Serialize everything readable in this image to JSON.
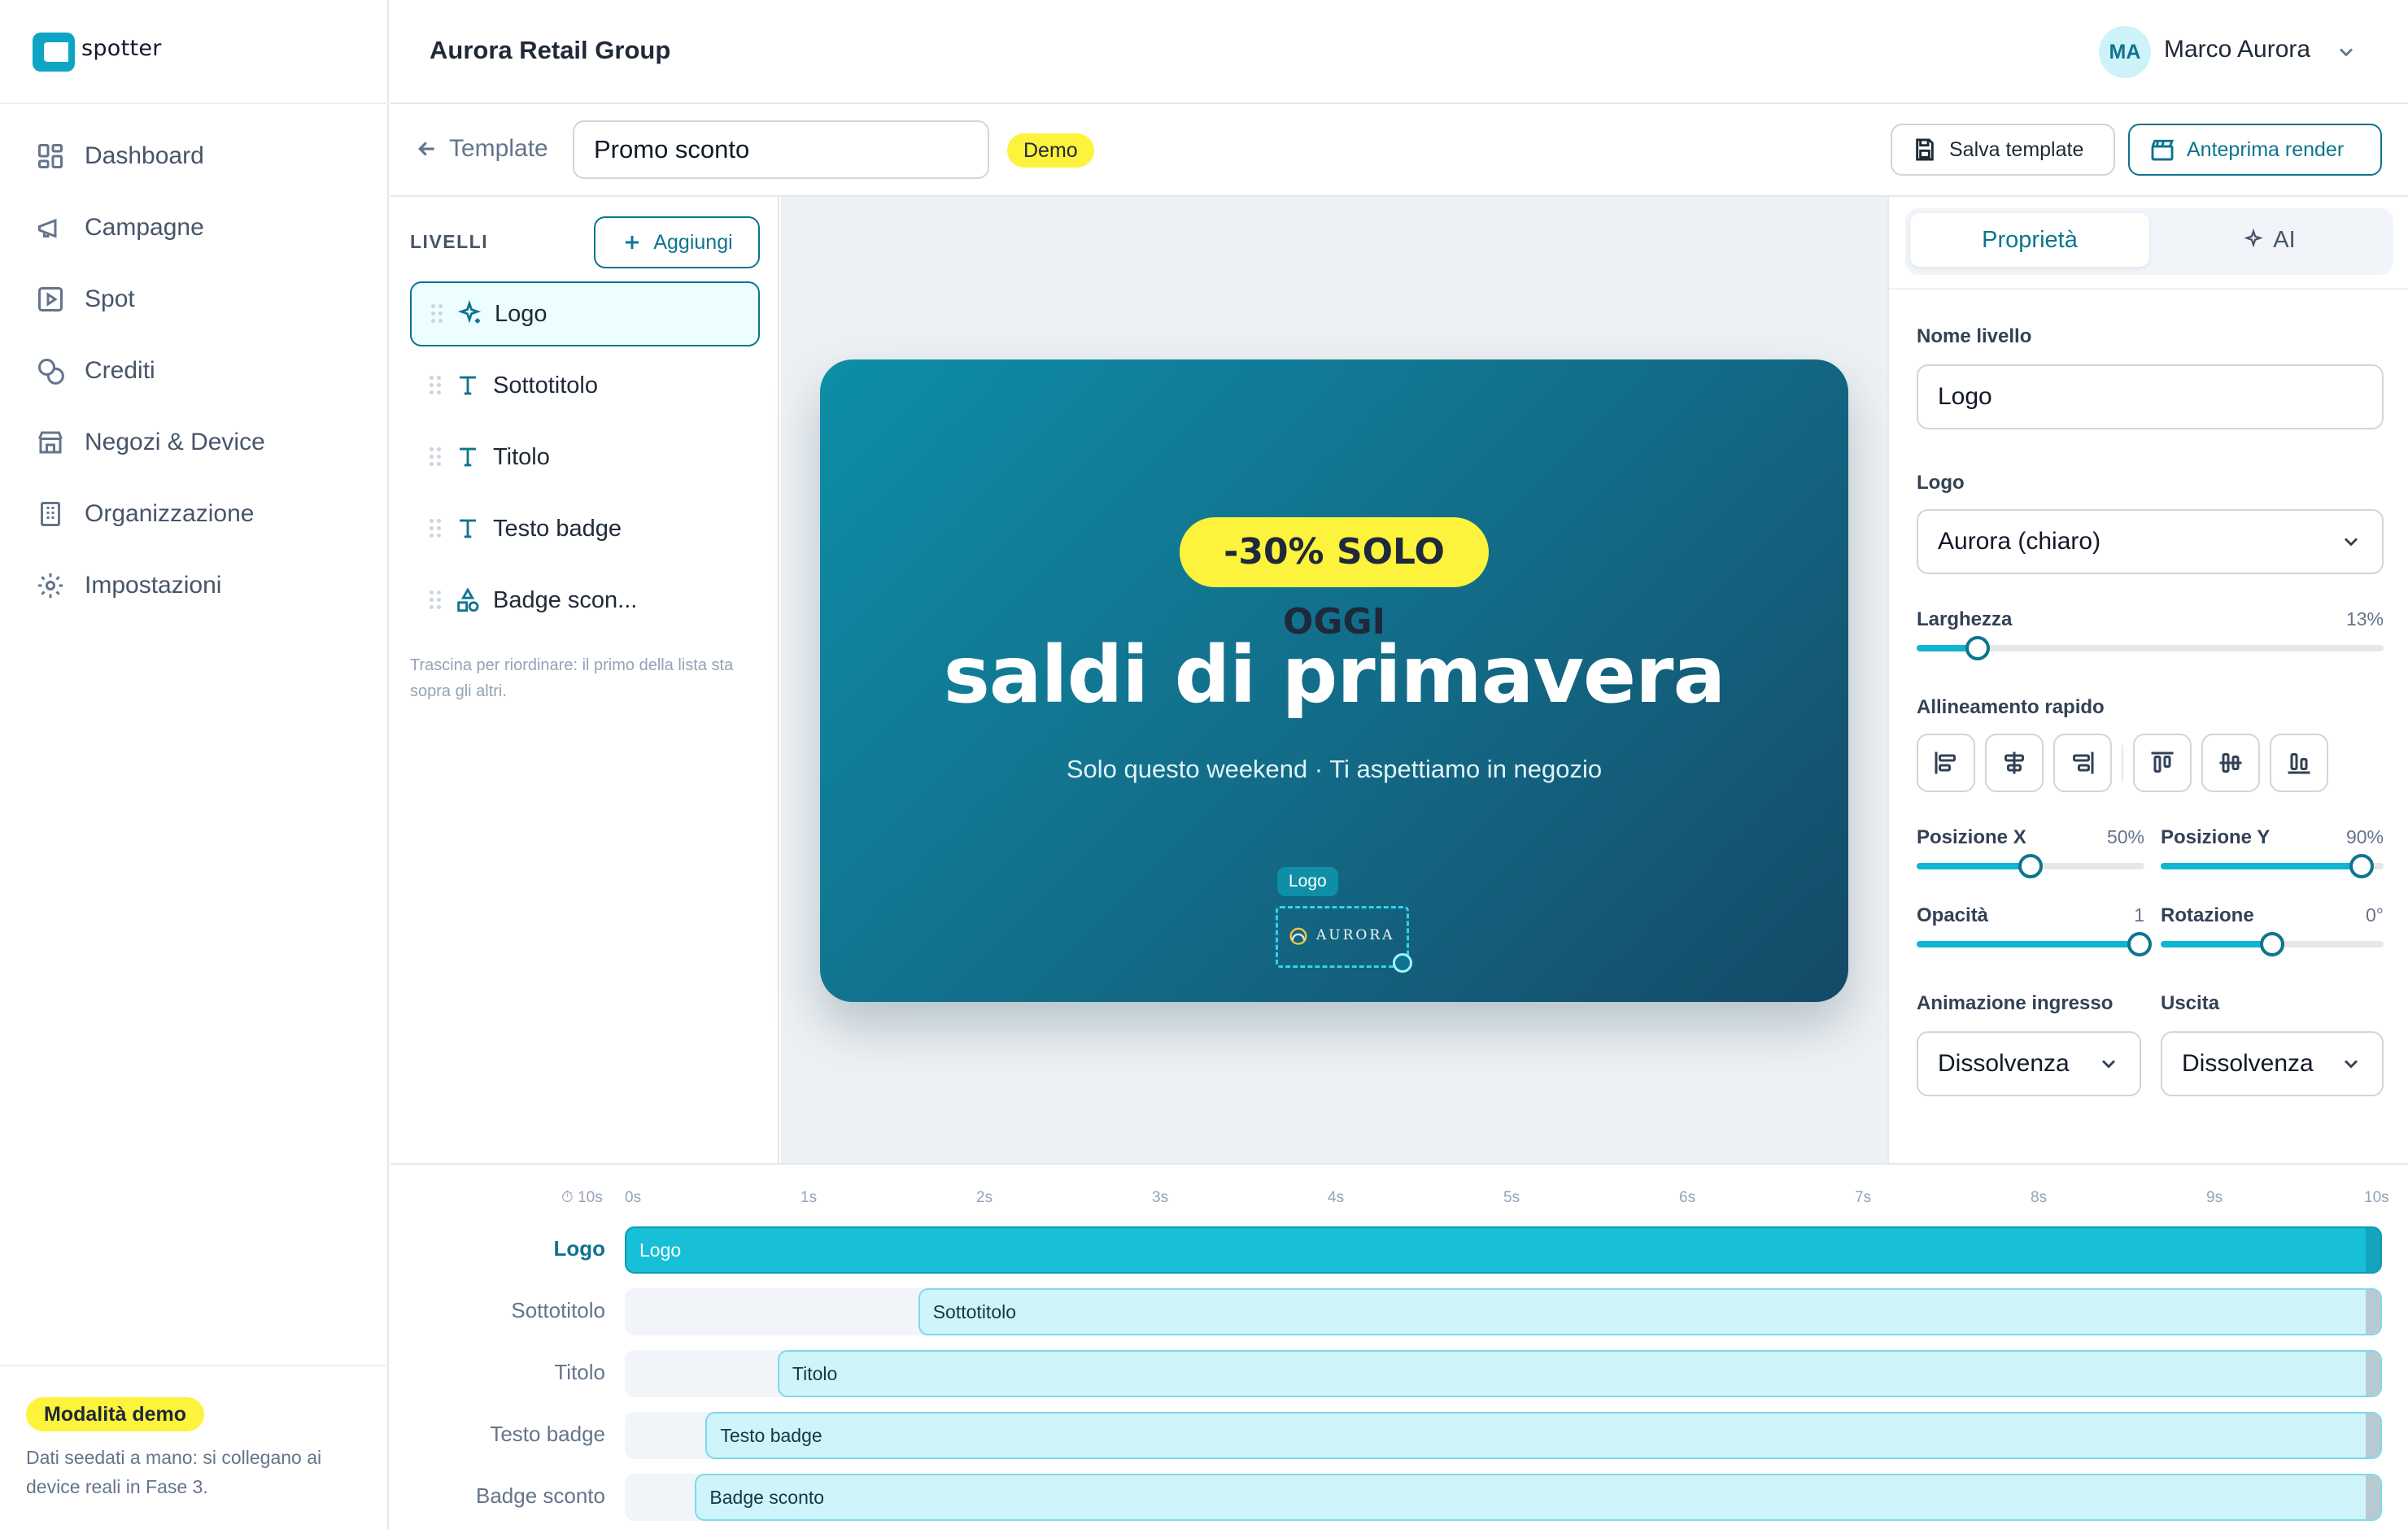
{
  "app": {
    "brand": "spotter",
    "org_title": "Aurora Retail Group",
    "user": {
      "initials": "MA",
      "name": "Marco Aurora"
    }
  },
  "sidebar": {
    "items": [
      {
        "label": "Dashboard",
        "icon": "grid-icon"
      },
      {
        "label": "Campagne",
        "icon": "megaphone-icon"
      },
      {
        "label": "Spot",
        "icon": "play-square-icon"
      },
      {
        "label": "Crediti",
        "icon": "coins-icon"
      },
      {
        "label": "Negozi & Device",
        "icon": "store-icon"
      },
      {
        "label": "Organizzazione",
        "icon": "building-icon"
      },
      {
        "label": "Impostazioni",
        "icon": "gear-icon"
      }
    ],
    "demo_badge": "Modalità demo",
    "demo_note": "Dati seedati a mano: si collegano ai device reali in Fase 3."
  },
  "toolbar": {
    "back_label": "Template",
    "template_name": "Promo sconto",
    "status_badge": "Demo",
    "save_label": "Salva template",
    "preview_label": "Anteprima render"
  },
  "layers": {
    "title": "LIVELLI",
    "add_label": "Aggiungi",
    "items": [
      {
        "label": "Logo",
        "icon": "sparkle-icon",
        "selected": true
      },
      {
        "label": "Sottotitolo",
        "icon": "text-icon",
        "selected": false
      },
      {
        "label": "Titolo",
        "icon": "text-icon",
        "selected": false
      },
      {
        "label": "Testo badge",
        "icon": "text-icon",
        "selected": false
      },
      {
        "label": "Badge scon...",
        "icon": "shapes-icon",
        "selected": false
      }
    ],
    "hint": "Trascina per riordinare: il primo della lista sta sopra gli altri."
  },
  "canvas": {
    "badge_text": "-30% SOLO OGGI",
    "title": "saldi di primavera",
    "subtitle": "Solo questo weekend · Ti aspettiamo in negozio",
    "selection_tag": "Logo",
    "logo_text": "AURORA",
    "colors": {
      "gradient_start": "#0e8ea8",
      "gradient_end": "#144a67",
      "badge": "#fdf33c"
    }
  },
  "properties": {
    "tabs": {
      "active": "Proprietà",
      "ai": "AI"
    },
    "layer_name_label": "Nome livello",
    "layer_name_value": "Logo",
    "logo_label": "Logo",
    "logo_value": "Aurora (chiaro)",
    "width_label": "Larghezza",
    "width_value": "13%",
    "width_fraction": 0.13,
    "align_label": "Allineamento rapido",
    "align_icons": [
      "align-left-icon",
      "align-center-h-icon",
      "align-right-icon",
      "align-top-icon",
      "align-middle-v-icon",
      "align-bottom-icon"
    ],
    "pos_x_label": "Posizione X",
    "pos_x_value": "50%",
    "pos_x_fraction": 0.5,
    "pos_y_label": "Posizione Y",
    "pos_y_value": "90%",
    "pos_y_fraction": 0.9,
    "opacity_label": "Opacità",
    "opacity_value": "1",
    "opacity_fraction": 1.0,
    "rotation_label": "Rotazione",
    "rotation_value": "0°",
    "rotation_fraction": 0.5,
    "anim_in_label": "Animazione ingresso",
    "anim_in_value": "Dissolvenza",
    "anim_out_label": "Uscita",
    "anim_out_value": "Dissolvenza"
  },
  "timeline": {
    "duration_label": "⏱ 10s",
    "ticks": [
      "0s",
      "1s",
      "2s",
      "3s",
      "4s",
      "5s",
      "6s",
      "7s",
      "8s",
      "9s",
      "10s"
    ],
    "rows": [
      {
        "label": "Logo",
        "bar": "Logo",
        "start_s": 0.0,
        "end_s": 10.0,
        "active": true
      },
      {
        "label": "Sottotitolo",
        "bar": "Sottotitolo",
        "start_s": 1.67,
        "end_s": 10.0,
        "active": false
      },
      {
        "label": "Titolo",
        "bar": "Titolo",
        "start_s": 0.87,
        "end_s": 10.0,
        "active": false
      },
      {
        "label": "Testo badge",
        "bar": "Testo badge",
        "start_s": 0.46,
        "end_s": 10.0,
        "active": false
      },
      {
        "label": "Badge sconto",
        "bar": "Badge sconto",
        "start_s": 0.4,
        "end_s": 10.0,
        "active": false
      }
    ]
  }
}
